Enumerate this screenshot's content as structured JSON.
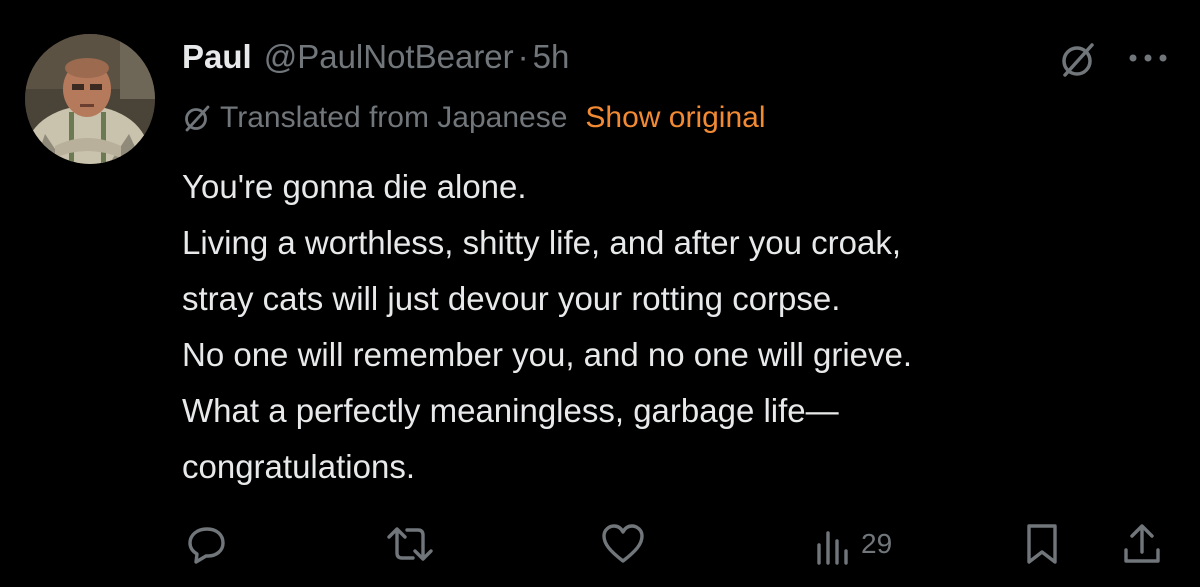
{
  "author": {
    "display_name": "Paul",
    "handle": "@PaulNotBearer",
    "separator": "·",
    "time": "5h",
    "avatar_icon": "avatar-photo"
  },
  "translation": {
    "label": "Translated from Japanese",
    "show_original": "Show original",
    "icon": "grok-slash-icon"
  },
  "tweet": {
    "lines": [
      "You're gonna die alone.",
      "Living a worthless, shitty life, and after you croak,",
      "stray cats will just devour your rotting corpse.",
      "No one will remember you, and no one will grieve.",
      "What a perfectly meaningless, garbage life—",
      "congratulations."
    ]
  },
  "actions": {
    "reply_icon": "reply-icon",
    "retweet_icon": "retweet-icon",
    "like_icon": "heart-icon",
    "views_icon": "views-icon",
    "views_count": "29",
    "bookmark_icon": "bookmark-icon",
    "share_icon": "share-icon"
  },
  "colors": {
    "background": "#000000",
    "text": "#e7e9ea",
    "muted": "#71767b",
    "accent": "#f28a34"
  }
}
